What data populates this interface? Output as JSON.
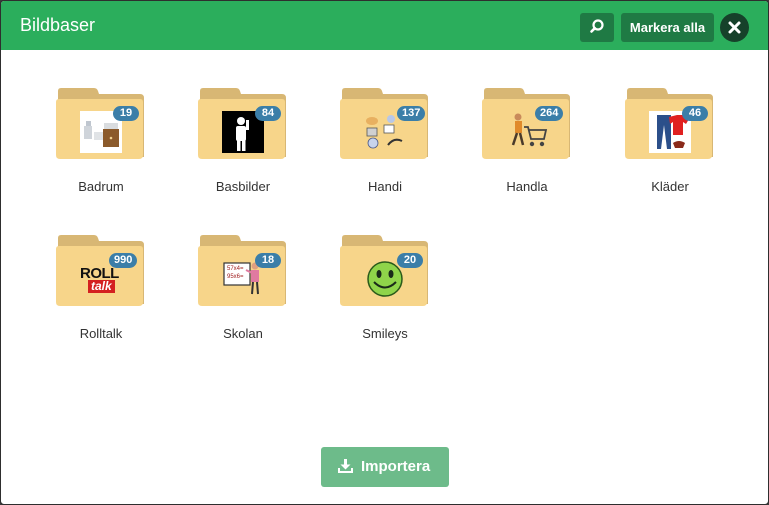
{
  "header": {
    "title": "Bildbaser",
    "search_icon": "search-icon",
    "select_all_label": "Markera alla",
    "close_icon": "close-icon"
  },
  "colors": {
    "header_bg": "#2bae5c",
    "header_button_bg": "#1f7a44",
    "close_bg": "#16412a",
    "folder_back": "#d8b774",
    "folder_front": "#f7d58a",
    "badge_bg": "#3b7ea8",
    "import_bg": "#6dbb8a"
  },
  "folders": [
    {
      "label": "Badrum",
      "count": "19",
      "thumb": "bathroom-picture"
    },
    {
      "label": "Basbilder",
      "count": "84",
      "thumb": "person-pictogram"
    },
    {
      "label": "Handi",
      "count": "137",
      "thumb": "daily-items-picture"
    },
    {
      "label": "Handla",
      "count": "264",
      "thumb": "shopping-cart-picture"
    },
    {
      "label": "Kläder",
      "count": "46",
      "thumb": "clothes-picture"
    },
    {
      "label": "Rolltalk",
      "count": "990",
      "thumb": "rolltalk-logo",
      "logo_text": [
        "ROLL",
        "talk"
      ]
    },
    {
      "label": "Skolan",
      "count": "18",
      "thumb": "teacher-whiteboard-picture",
      "board_text": [
        "57x4=",
        "95x6="
      ]
    },
    {
      "label": "Smileys",
      "count": "20",
      "thumb": "smiley-face-picture"
    }
  ],
  "footer": {
    "import_label": "Importera",
    "import_icon": "download-icon"
  }
}
